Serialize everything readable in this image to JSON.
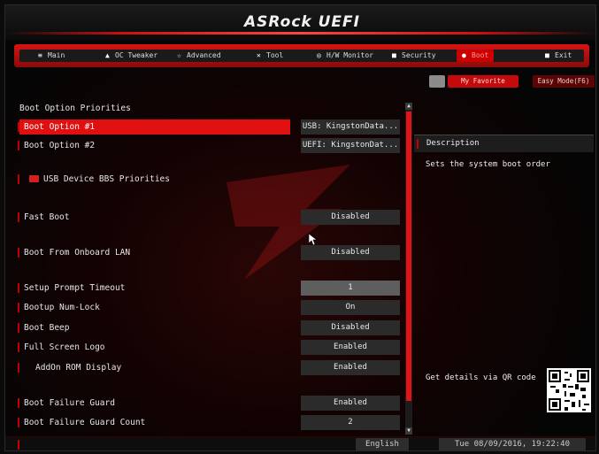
{
  "header": {
    "logo": "ASRock UEFI"
  },
  "nav": {
    "tabs": [
      {
        "label": "Main",
        "icon": "list-icon"
      },
      {
        "label": "OC Tweaker",
        "icon": "tweaker-icon"
      },
      {
        "label": "Advanced",
        "icon": "star-icon"
      },
      {
        "label": "Tool",
        "icon": "wrench-icon"
      },
      {
        "label": "H/W Monitor",
        "icon": "monitor-icon"
      },
      {
        "label": "Security",
        "icon": "shield-icon"
      },
      {
        "label": "Boot",
        "icon": "power-icon"
      },
      {
        "label": "Exit",
        "icon": "exit-icon"
      }
    ],
    "active_tab": "Boot"
  },
  "buttons": {
    "favorite": "My Favorite",
    "easy_mode": "Easy Mode(F6)"
  },
  "main": {
    "section_title": "Boot Option Priorities",
    "rows": [
      {
        "label": "Boot Option #1",
        "value": "USB: KingstonData...",
        "highlighted": true
      },
      {
        "label": "Boot Option #2",
        "value": "UEFI: KingstonDat..."
      },
      {
        "label": "USB Device BBS Priorities",
        "value": ""
      },
      {
        "label": "Fast Boot",
        "value": "Disabled"
      },
      {
        "label": "Boot From Onboard LAN",
        "value": "Disabled"
      },
      {
        "label": "Setup Prompt Timeout",
        "value": "1"
      },
      {
        "label": "Bootup Num-Lock",
        "value": "On"
      },
      {
        "label": "Boot Beep",
        "value": "Disabled"
      },
      {
        "label": "Full Screen Logo",
        "value": "Enabled"
      },
      {
        "label": "AddOn ROM Display",
        "value": "Enabled"
      },
      {
        "label": "Boot Failure Guard",
        "value": "Enabled"
      },
      {
        "label": "Boot Failure Guard Count",
        "value": "2"
      }
    ]
  },
  "description": {
    "title": "Description",
    "text": "Sets the system boot order",
    "qr_label": "Get details via QR code"
  },
  "footer": {
    "language": "English",
    "datetime": "Tue 08/09/2016, 19:22:40"
  },
  "colors": {
    "accent": "#e01010",
    "dark": "#0b0b0b",
    "panel": "#2b2b2b"
  }
}
